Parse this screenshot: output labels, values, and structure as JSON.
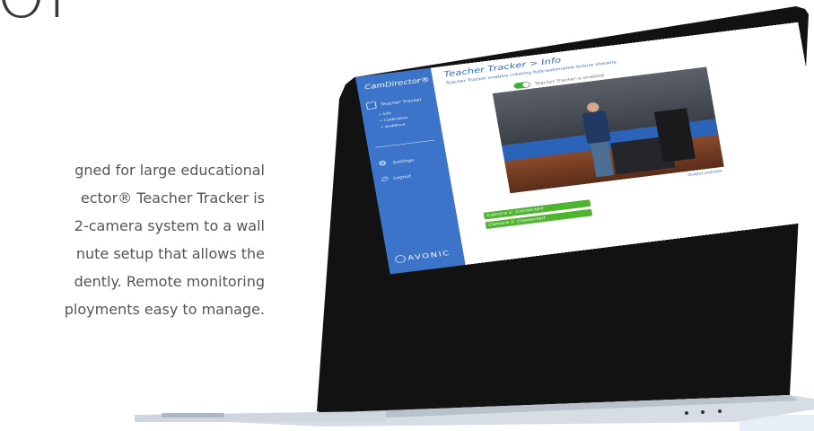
{
  "page": {
    "heading_fragment": "OI",
    "description_lines": [
      "gned for large educational",
      "ector® Teacher Tracker is",
      "2-camera system to a wall",
      "nute setup that allows the",
      "dently. Remote monitoring",
      "ployments easy to manage."
    ]
  },
  "app": {
    "brand": "CamDirector®",
    "logo_text": "AVONIC",
    "sidebar": {
      "teacher_tracker_label": "Teacher Tracker",
      "sub_items": [
        "• Info",
        "• Calibration",
        "• Audience"
      ],
      "settings_label": "Settings",
      "logout_label": "Logout"
    },
    "main": {
      "title": "Teacher Tracker > Info",
      "subtitle": "Teacher Tracker enables creating fully-automated lecture streams.",
      "toggle_label": "Teacher Tracker is enabled",
      "toggle_state": "on",
      "output_label": "Output preview",
      "camera_status": [
        "Camera 1: Connected",
        "Camera 2: Connected"
      ]
    }
  },
  "icons": {
    "teacher_tracker": "person-icon",
    "settings": "gear-icon",
    "logout": "power-icon",
    "logo": "avonic-logo-icon"
  },
  "colors": {
    "sidebar": "#3b74c8",
    "accent": "#2f69c0",
    "status_green": "#4fb52f"
  }
}
